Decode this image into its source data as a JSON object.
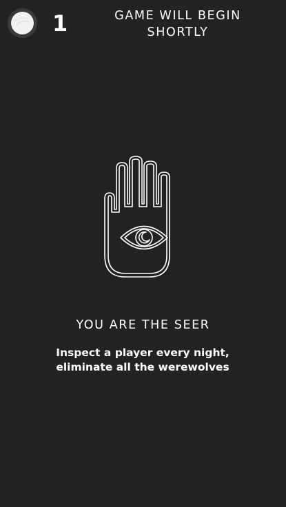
{
  "header": {
    "player_number": "1",
    "status_line1": "GAME WILL BEGIN",
    "status_line2": "SHORTLY",
    "avatar_icon": "player-avatar-icon"
  },
  "role": {
    "icon": "seer-hand-eye-icon",
    "title": "YOU ARE THE SEER",
    "description_line1": "Inspect a player every night,",
    "description_line2": "eliminate all the werewolves"
  },
  "colors": {
    "background": "#222222",
    "foreground": "#ffffff",
    "avatar_ring": "#3a3a3a",
    "avatar_fill": "#f2f2f2"
  }
}
